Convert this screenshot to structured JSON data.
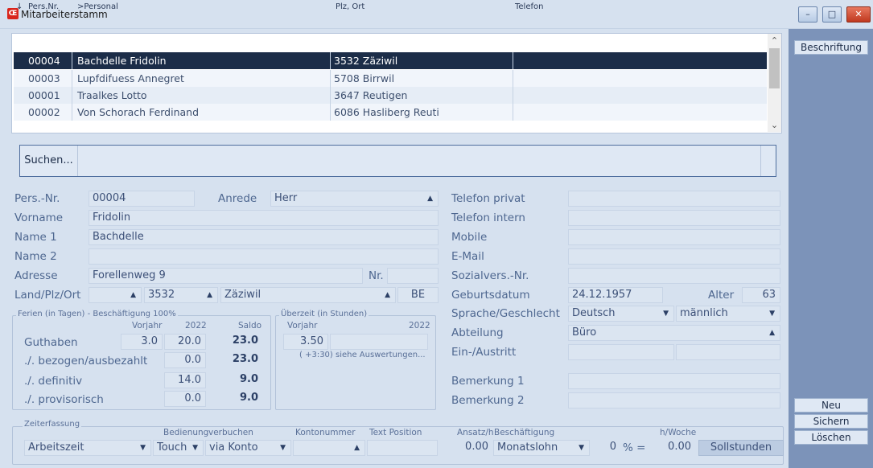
{
  "window": {
    "title": "Mitarbeiterstamm",
    "icon": "app-logo-icon",
    "min": "–",
    "max": "□",
    "close": "✕"
  },
  "sidebar": {
    "label_button": "Beschriftung",
    "new_button": "Neu",
    "save_button": "Sichern",
    "delete_button": "Löschen"
  },
  "grid": {
    "sort_icon": "↓",
    "columns": [
      "Pers.Nr.",
      ">Personal",
      "Plz, Ort",
      "Telefon"
    ],
    "rows": [
      {
        "nr": "00004",
        "name": "Bachdelle Fridolin",
        "ort": "3532  Zäziwil",
        "tel": ""
      },
      {
        "nr": "00003",
        "name": "Lupfdifuess Annegret",
        "ort": "5708  Birrwil",
        "tel": ""
      },
      {
        "nr": "00001",
        "name": "Traalkes Lotto",
        "ort": "3647  Reutigen",
        "tel": ""
      },
      {
        "nr": "00002",
        "name": "Von Schorach Ferdinand",
        "ort": "6086  Hasliberg Reuti",
        "tel": ""
      }
    ],
    "scroll_up": "⌃",
    "scroll_down": "⌄"
  },
  "search": {
    "label": "Suchen..."
  },
  "form": {
    "persnr_label": "Pers.-Nr.",
    "persnr": "00004",
    "anrede_label": "Anrede",
    "anrede": "Herr",
    "vorname_label": "Vorname",
    "vorname": "Fridolin",
    "name1_label": "Name 1",
    "name1": "Bachdelle",
    "name2_label": "Name 2",
    "name2": "",
    "adresse_label": "Adresse",
    "adresse": "Forellenweg 9",
    "nr_label": "Nr.",
    "nr": "",
    "land_label": "Land/Plz/Ort",
    "land": "",
    "plz": "3532",
    "ort": "Zäziwil",
    "kanton": "BE",
    "tel_privat_label": "Telefon privat",
    "tel_intern_label": "Telefon intern",
    "mobile_label": "Mobile",
    "email_label": "E-Mail",
    "sozial_label": "Sozialvers.-Nr.",
    "geburt_label": "Geburtsdatum",
    "geburt": "24.12.1957",
    "alter_label": "Alter",
    "alter": "63",
    "sprache_label": "Sprache/Geschlecht",
    "sprache": "Deutsch",
    "geschlecht": "männlich",
    "abteilung_label": "Abteilung",
    "abteilung": "Büro",
    "einaus_label": "Ein-/Austritt",
    "bem1_label": "Bemerkung 1",
    "bem2_label": "Bemerkung 2"
  },
  "ferien": {
    "title": "Ferien (in Tagen) - Beschäftigung 100%",
    "col_vorjahr": "Vorjahr",
    "col_year": "2022",
    "col_saldo": "Saldo",
    "guthaben_label": "Guthaben",
    "guthaben_vorjahr": "3.0",
    "guthaben_year": "20.0",
    "guthaben_saldo": "23.0",
    "bezogen_label": "./. bezogen/ausbezahlt",
    "bezogen_year": "0.0",
    "bezogen_saldo": "23.0",
    "definitiv_label": "./. definitiv",
    "definitiv_year": "14.0",
    "definitiv_saldo": "9.0",
    "provisorisch_label": "./. provisorisch",
    "provisorisch_year": "0.0",
    "provisorisch_saldo": "9.0"
  },
  "ueberzeit": {
    "title": "Überzeit (in Stunden)",
    "col_vorjahr": "Vorjahr",
    "col_year": "2022",
    "vorjahr": "3.50",
    "note": "( +3:30)  siehe Auswertungen..."
  },
  "zeit": {
    "title": "Zeiterfassung",
    "bedienung_label": "Bedienung",
    "verbuchen_label": "verbuchen",
    "konto_label": "Kontonummer",
    "textpos_label": "Text Position",
    "ansatz_label": "Ansatz/h",
    "beschaeft_label": "Beschäftigung",
    "hwoche_label": "h/Woche",
    "art": "Arbeitszeit",
    "bedienung": "Touch",
    "verbuchen": "via Konto",
    "ansatz": "0.00",
    "beschaeftigung": "Monatslohn",
    "prozent": "0",
    "pct_eq": "% =",
    "hwoche": "0.00",
    "sollstunden": "Sollstunden"
  }
}
